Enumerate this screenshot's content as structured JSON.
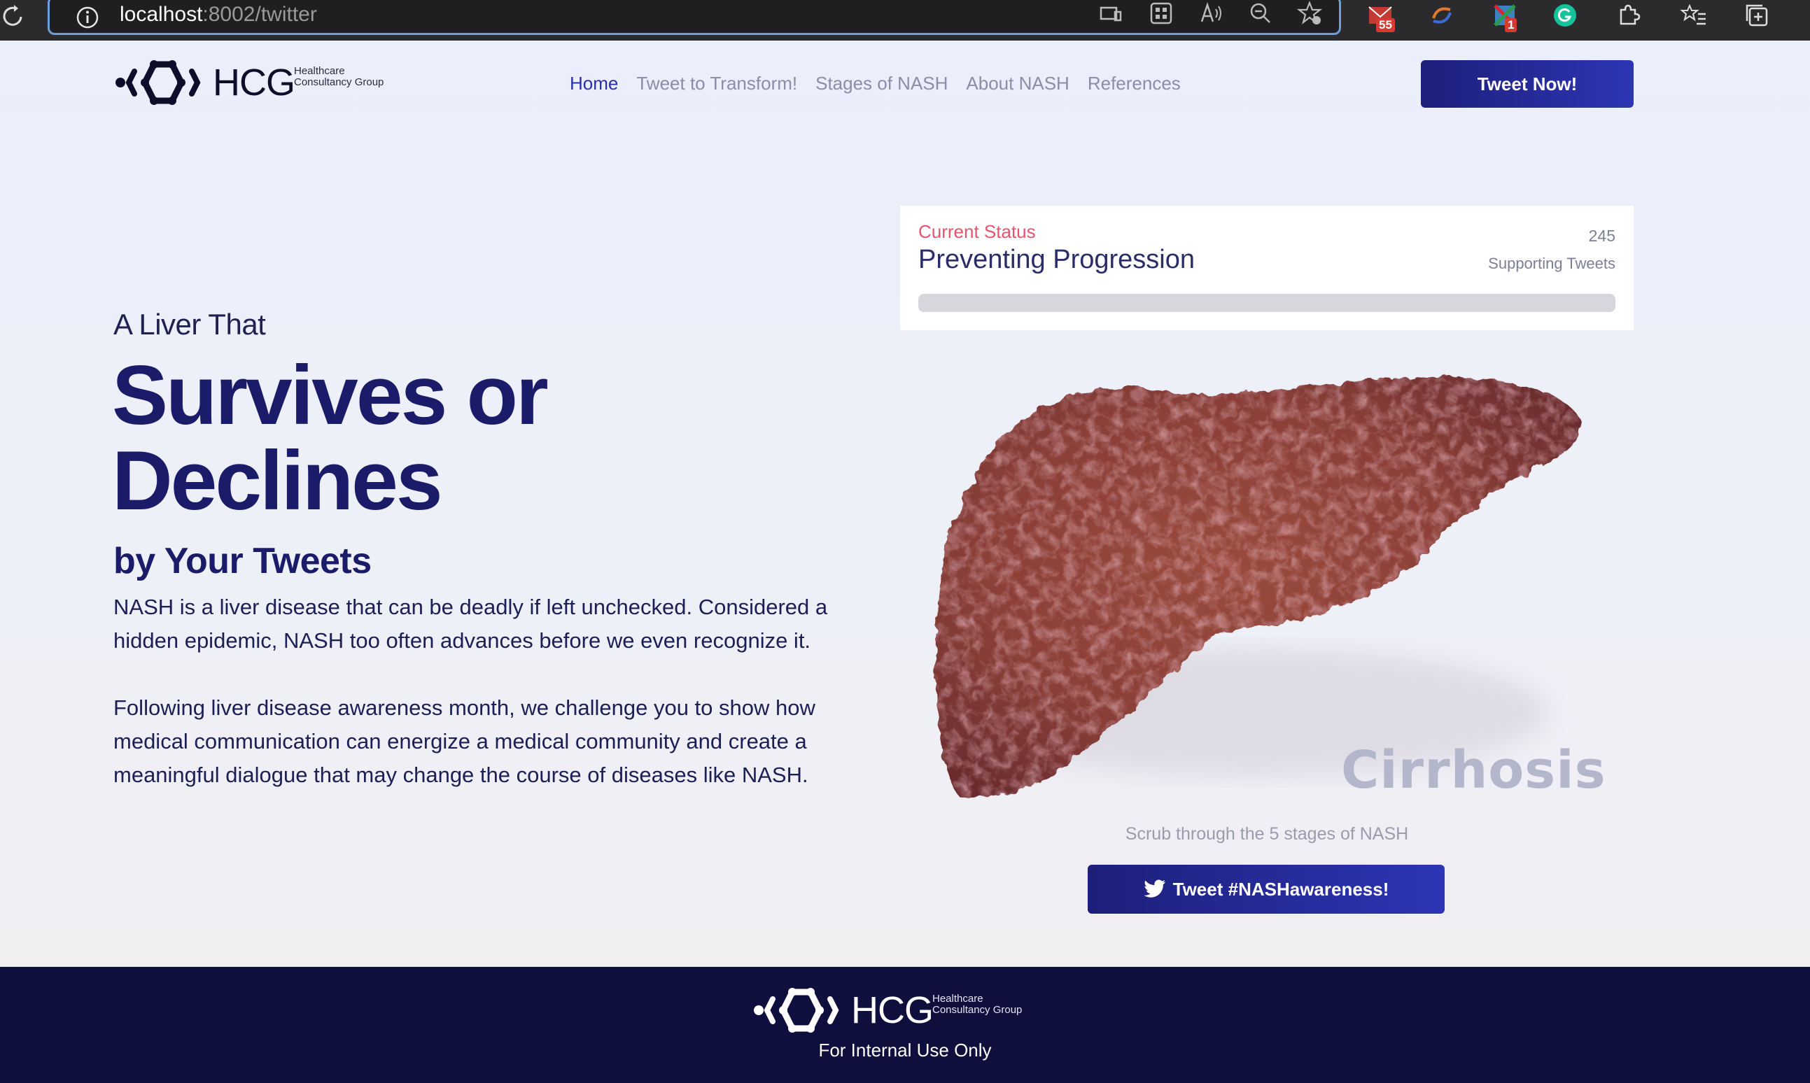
{
  "browser": {
    "url_host": "localhost",
    "url_path": ":8002/twitter",
    "mail_badge": "55",
    "ext_badge": "1"
  },
  "header": {
    "logo_text": "HCG",
    "logo_sub": "Healthcare Consultancy Group",
    "nav": [
      {
        "label": "Home",
        "active": true
      },
      {
        "label": "Tweet to Transform!"
      },
      {
        "label": "Stages of NASH"
      },
      {
        "label": "About NASH"
      },
      {
        "label": "References"
      }
    ],
    "cta_label": "Tweet Now!"
  },
  "hero": {
    "kicker": "A Liver That",
    "title": "Survives or Declines",
    "subtitle": "by Your Tweets",
    "paragraph_1": "NASH is a liver disease that can be deadly if left unchecked. Considered a hidden epidemic, NASH too often advances before we even recognize it.",
    "paragraph_2": "Following liver disease awareness month, we challenge you to show how medical communication can energize a medical community and create a meaningful dialogue that may change the course of diseases like NASH."
  },
  "status": {
    "label": "Current Status",
    "value": "Preventing Progression",
    "count": "245",
    "count_label": "Supporting Tweets",
    "progress": 0
  },
  "liver_panel": {
    "stage_name": "Cirrhosis",
    "scrub_hint": "Scrub through the 5 stages of NASH",
    "tweet_button_label": "Tweet #NASHawareness!"
  },
  "footer": {
    "logo_text": "HCG",
    "logo_sub": "Healthcare Consultancy Group",
    "note": "For Internal Use Only"
  }
}
